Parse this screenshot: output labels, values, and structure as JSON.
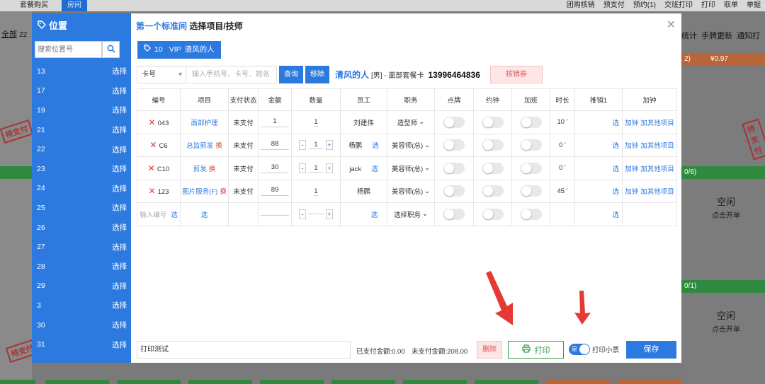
{
  "background": {
    "tabs": [
      "套餐购买",
      "房间"
    ],
    "right_menu": [
      "团购核销",
      "预支付",
      "预约(1)",
      "交班打印",
      "打印",
      "取单",
      "单据"
    ],
    "all_label": "全部",
    "all_count": "22",
    "right_tools": [
      "统计",
      "手牌更新",
      "通知打"
    ],
    "idle_title": "空闲",
    "idle_sub": "点击开单",
    "stamp": "待支付",
    "orange_label": "2)",
    "orange_amount": "¥0.97",
    "green_label_1": "0/6)",
    "green_label_2": "0/1)"
  },
  "sidebar": {
    "title": "位置",
    "search_placeholder": "搜索位置号",
    "select_label": "选择",
    "positions": [
      "13",
      "17",
      "19",
      "21",
      "22",
      "23",
      "24",
      "25",
      "26",
      "27",
      "28",
      "29",
      "3",
      "30",
      "31"
    ]
  },
  "header": {
    "room": "第一个标准间",
    "subtitle": "选择项目/技师"
  },
  "vip_tag": {
    "number": "10",
    "level": "VIP",
    "name": "清风的人"
  },
  "search": {
    "card_type": "卡号",
    "placeholder": "输入手机号、卡号、姓名",
    "query_label": "查询",
    "remove_label": "移除"
  },
  "member": {
    "name": "清风的人",
    "info": "[男] - 面部套餐卡",
    "phone": "13996464836"
  },
  "verify_button": "核销券",
  "table": {
    "headers": [
      "编号",
      "项目",
      "支付状态",
      "金额",
      "数量",
      "员工",
      "职务",
      "点牌",
      "约钟",
      "加班",
      "时长",
      "推销1",
      "加钟"
    ],
    "rows": [
      {
        "code": "043",
        "item": "面部护理",
        "swap": "",
        "status": "未支付",
        "amount": "1",
        "qty": "1",
        "employee": "刘建伟",
        "emp_select": "",
        "role": "造型师",
        "duration": "10 '",
        "sell": "选",
        "add1": "加钟",
        "add2": "加其他项目"
      },
      {
        "code": "C6",
        "item": "总监剪发",
        "swap": "换",
        "status": "未支付",
        "amount": "88",
        "qty": "1",
        "employee": "杨鹏",
        "emp_select": "选",
        "role": "美容师(总)",
        "duration": "0 '",
        "sell": "选",
        "add1": "加钟",
        "add2": "加其他项目"
      },
      {
        "code": "C10",
        "item": "剪发",
        "swap": "换",
        "status": "未支付",
        "amount": "30",
        "qty": "1",
        "employee": "jack",
        "emp_select": "选",
        "role": "美容师(总)",
        "duration": "0 '",
        "sell": "选",
        "add1": "加钟",
        "add2": "加其他项目"
      },
      {
        "code": "123",
        "item": "图片服务(F)",
        "swap": "换",
        "status": "未支付",
        "amount": "89",
        "qty": "1",
        "employee": "杨鹏",
        "emp_select": "",
        "role": "美容师(总)",
        "duration": "45 '",
        "sell": "选",
        "add1": "加钟",
        "add2": "加其他项目"
      }
    ],
    "new_row": {
      "code_placeholder": "输入编号",
      "select": "选",
      "role_placeholder": "选择职务"
    }
  },
  "footer": {
    "remark": "打印测试",
    "paid": "已支付金额:0.00",
    "unpaid": "未支付金额:208.00",
    "delete_label": "删除",
    "print_label": "打印",
    "switch_on_text": "是",
    "ticket_label": "打印小票",
    "save_label": "保存"
  },
  "colors": {
    "primary": "#2c7ae0",
    "danger": "#e03c3c",
    "success": "#2f9e48",
    "arrow": "#e53935"
  }
}
